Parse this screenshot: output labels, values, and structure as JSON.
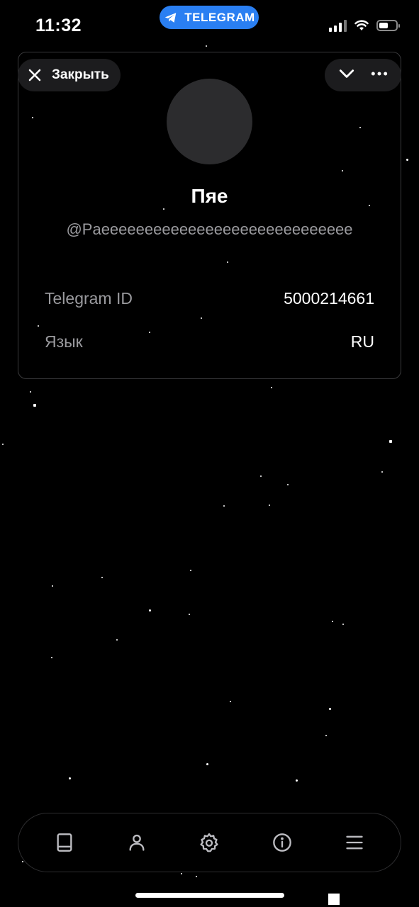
{
  "status_bar": {
    "time": "11:32",
    "pill_label": "TELEGRAM",
    "pill_color": "#2a7ff2",
    "battery_level": 0.55
  },
  "header": {
    "close_label": "Закрыть",
    "close_icon": "close-icon",
    "collapse_icon": "chevron-down-icon",
    "menu_icon": "more-dots-icon"
  },
  "profile": {
    "name": "Пяе",
    "username": "@Paeeeeeeeeeeeeeeeeeeeeeeeeeeeee",
    "fields": [
      {
        "label": "Telegram ID",
        "value": "5000214661"
      },
      {
        "label": "Язык",
        "value": "RU"
      }
    ]
  },
  "tabbar": {
    "items": [
      {
        "icon": "book-icon"
      },
      {
        "icon": "user-icon"
      },
      {
        "icon": "gear-icon"
      },
      {
        "icon": "info-icon"
      },
      {
        "icon": "menu-icon"
      }
    ]
  },
  "colors": {
    "background": "#000000",
    "card_border": "#3a3a3c",
    "button_bg": "#1c1c1e",
    "muted_text": "#9a9a9e"
  }
}
